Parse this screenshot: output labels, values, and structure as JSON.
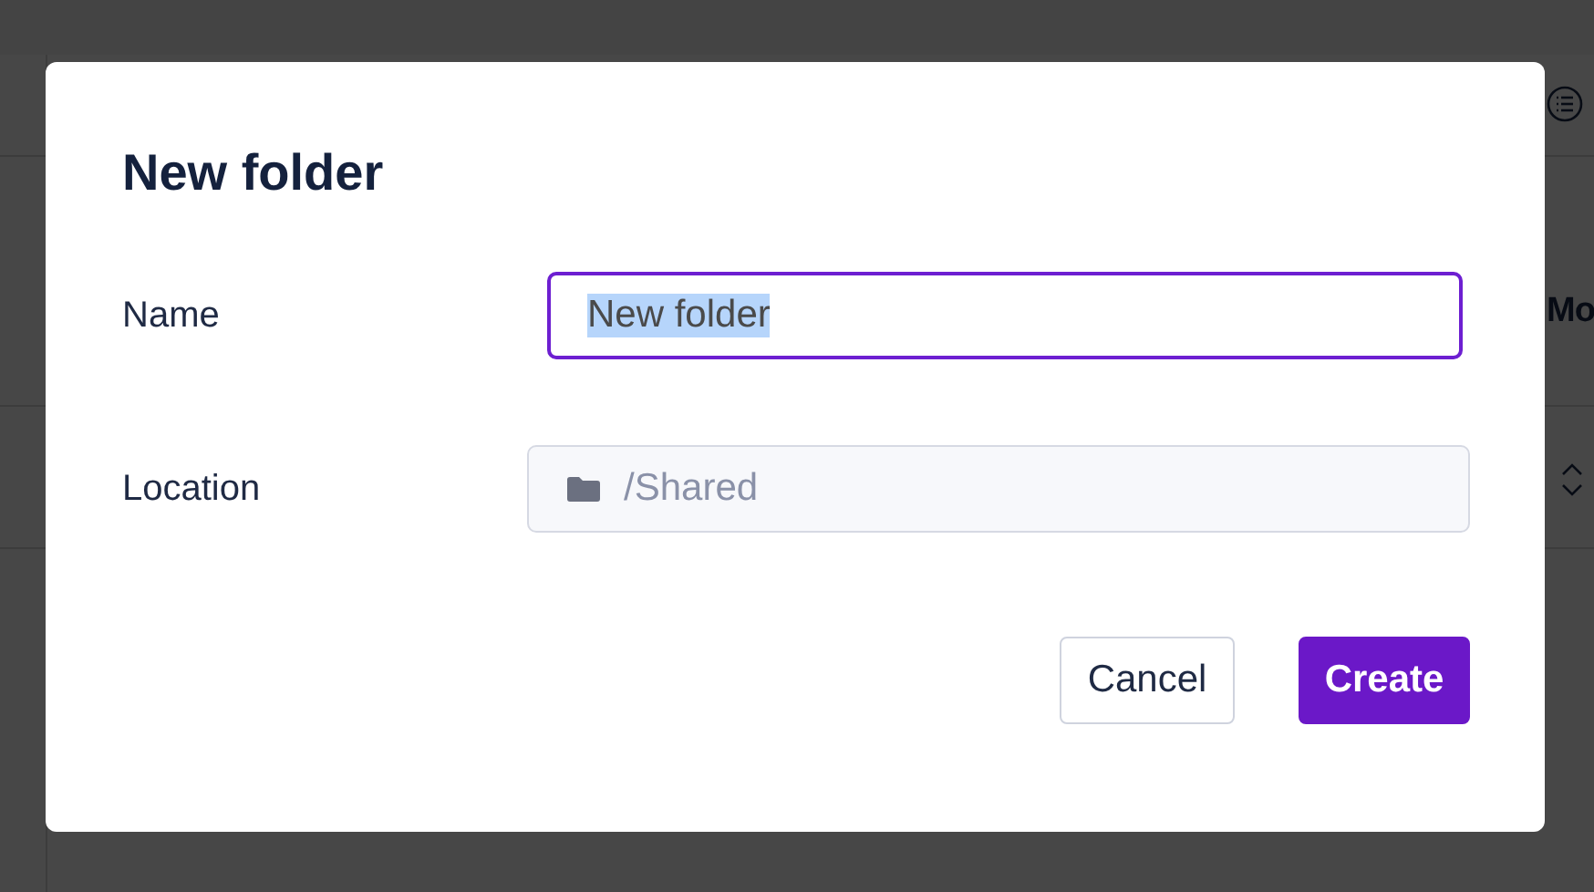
{
  "background": {
    "column_heading": "Mo"
  },
  "dialog": {
    "title": "New folder",
    "fields": [
      {
        "kind": "text",
        "label": "Name",
        "value": "New folder",
        "value_selected": true,
        "focused": true
      },
      {
        "kind": "path",
        "label": "Location",
        "value": "/Shared",
        "disabled": true
      }
    ],
    "buttons": [
      {
        "kind": "secondary",
        "label": "Cancel"
      },
      {
        "kind": "primary",
        "label": "Create"
      }
    ]
  }
}
